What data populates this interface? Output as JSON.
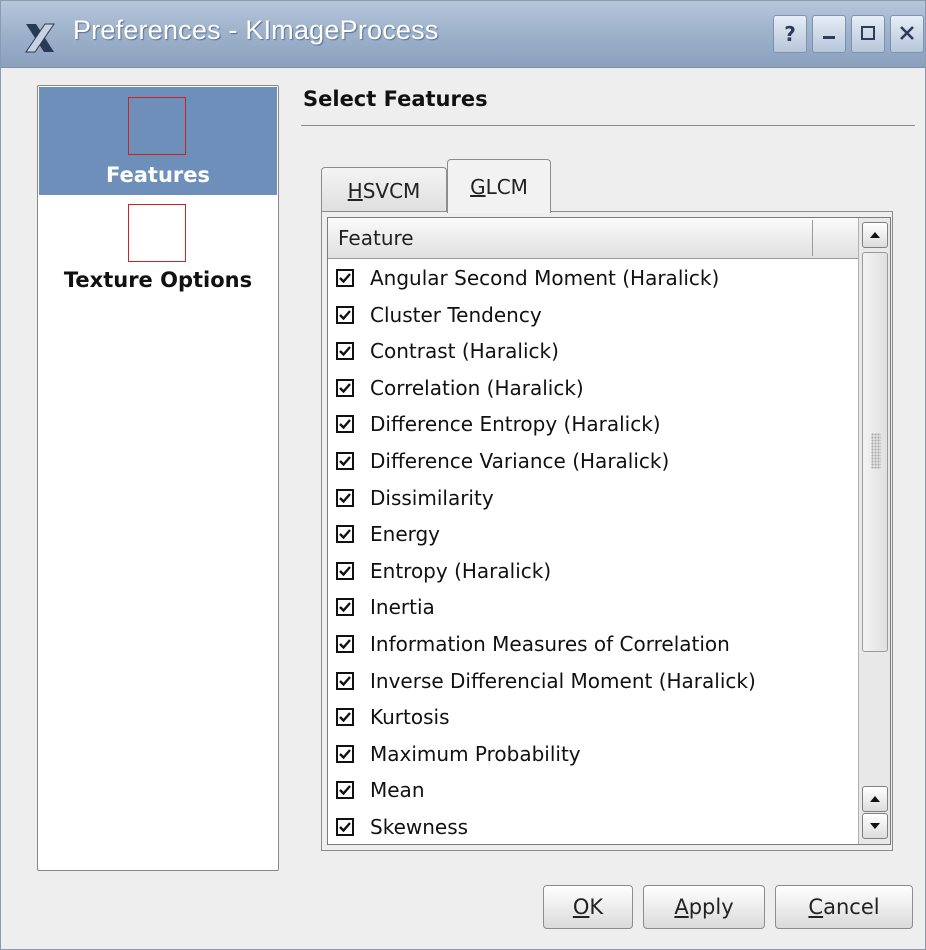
{
  "window": {
    "title": "Preferences - KImageProcess",
    "controls": {
      "help": "?",
      "minimize": "_",
      "maximize": "□",
      "close": "✕"
    }
  },
  "nav": {
    "items": [
      {
        "label": "Features",
        "selected": true
      },
      {
        "label": "Texture Options",
        "selected": false
      }
    ]
  },
  "page": {
    "title": "Select Features"
  },
  "tabs": [
    {
      "mnemonic": "H",
      "rest": "SVCM",
      "active": false
    },
    {
      "mnemonic": "G",
      "rest": "LCM",
      "active": true
    }
  ],
  "list": {
    "column_header": "Feature",
    "items": [
      {
        "label": "Angular Second Moment (Haralick)",
        "checked": true
      },
      {
        "label": "Cluster Tendency",
        "checked": true
      },
      {
        "label": "Contrast (Haralick)",
        "checked": true
      },
      {
        "label": "Correlation (Haralick)",
        "checked": true
      },
      {
        "label": "Difference Entropy (Haralick)",
        "checked": true
      },
      {
        "label": "Difference Variance (Haralick)",
        "checked": true
      },
      {
        "label": "Dissimilarity",
        "checked": true
      },
      {
        "label": "Energy",
        "checked": true
      },
      {
        "label": "Entropy (Haralick)",
        "checked": true
      },
      {
        "label": "Inertia",
        "checked": true
      },
      {
        "label": "Information Measures of Correlation",
        "checked": true
      },
      {
        "label": "Inverse Differencial Moment (Haralick)",
        "checked": true
      },
      {
        "label": "Kurtosis",
        "checked": true
      },
      {
        "label": "Maximum Probability",
        "checked": true
      },
      {
        "label": "Mean",
        "checked": true
      },
      {
        "label": "Skewness",
        "checked": true
      }
    ]
  },
  "buttons": {
    "ok": {
      "mnemonic": "O",
      "rest": "K"
    },
    "apply": {
      "mnemonic": "A",
      "rest": "pply"
    },
    "cancel": {
      "mnemonic": "C",
      "rest": "ancel"
    }
  },
  "colors": {
    "selection": "#6d8fb9",
    "titlebar": "#9fb3cc",
    "placeholder_icon_border": "#cc2222"
  }
}
